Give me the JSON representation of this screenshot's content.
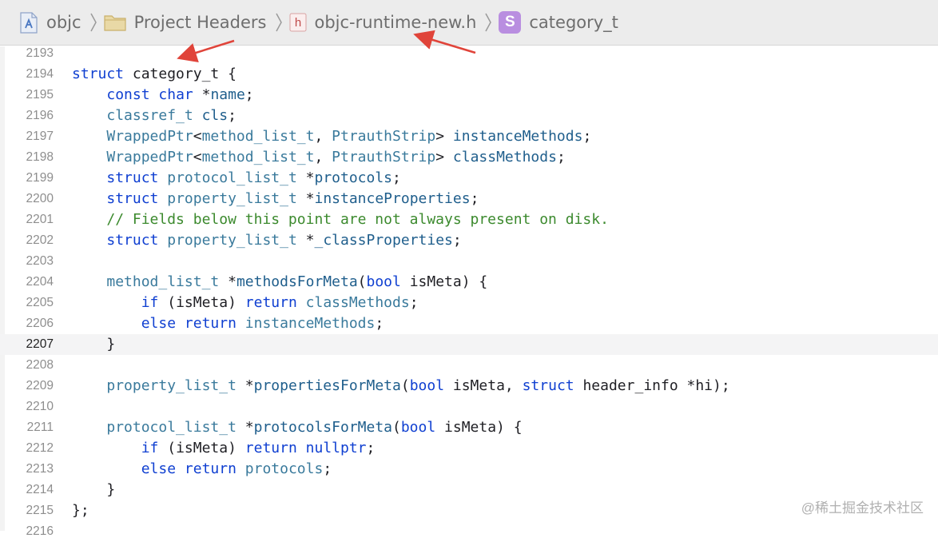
{
  "breadcrumb": {
    "items": [
      {
        "label": "objc",
        "icon": "xcode-project-icon"
      },
      {
        "label": "Project Headers",
        "icon": "folder-icon"
      },
      {
        "label": "objc-runtime-new.h",
        "icon": "header-file-icon",
        "icon_text": "h"
      },
      {
        "label": "category_t",
        "icon": "struct-symbol-icon",
        "icon_text": "S"
      }
    ]
  },
  "editor": {
    "current_line": "2207",
    "lines": [
      {
        "num": "2193",
        "tokens": []
      },
      {
        "num": "2194",
        "tokens": [
          [
            "kw",
            "struct"
          ],
          [
            "pl",
            " category_t {"
          ]
        ]
      },
      {
        "num": "2195",
        "tokens": [
          [
            "pl",
            "    "
          ],
          [
            "kw",
            "const"
          ],
          [
            "pl",
            " "
          ],
          [
            "kw",
            "char"
          ],
          [
            "pl",
            " *"
          ],
          [
            "fn",
            "name"
          ],
          [
            "pl",
            ";"
          ]
        ]
      },
      {
        "num": "2196",
        "tokens": [
          [
            "pl",
            "    "
          ],
          [
            "ty",
            "classref_t"
          ],
          [
            "pl",
            " "
          ],
          [
            "fn",
            "cls"
          ],
          [
            "pl",
            ";"
          ]
        ]
      },
      {
        "num": "2197",
        "tokens": [
          [
            "pl",
            "    "
          ],
          [
            "ty",
            "WrappedPtr"
          ],
          [
            "pl",
            "<"
          ],
          [
            "ty",
            "method_list_t"
          ],
          [
            "pl",
            ", "
          ],
          [
            "ty",
            "PtrauthStrip"
          ],
          [
            "pl",
            "> "
          ],
          [
            "fn",
            "instanceMethods"
          ],
          [
            "pl",
            ";"
          ]
        ]
      },
      {
        "num": "2198",
        "tokens": [
          [
            "pl",
            "    "
          ],
          [
            "ty",
            "WrappedPtr"
          ],
          [
            "pl",
            "<"
          ],
          [
            "ty",
            "method_list_t"
          ],
          [
            "pl",
            ", "
          ],
          [
            "ty",
            "PtrauthStrip"
          ],
          [
            "pl",
            "> "
          ],
          [
            "fn",
            "classMethods"
          ],
          [
            "pl",
            ";"
          ]
        ]
      },
      {
        "num": "2199",
        "tokens": [
          [
            "pl",
            "    "
          ],
          [
            "kw",
            "struct"
          ],
          [
            "pl",
            " "
          ],
          [
            "ty",
            "protocol_list_t"
          ],
          [
            "pl",
            " *"
          ],
          [
            "fn",
            "protocols"
          ],
          [
            "pl",
            ";"
          ]
        ]
      },
      {
        "num": "2200",
        "tokens": [
          [
            "pl",
            "    "
          ],
          [
            "kw",
            "struct"
          ],
          [
            "pl",
            " "
          ],
          [
            "ty",
            "property_list_t"
          ],
          [
            "pl",
            " *"
          ],
          [
            "fn",
            "instanceProperties"
          ],
          [
            "pl",
            ";"
          ]
        ]
      },
      {
        "num": "2201",
        "tokens": [
          [
            "pl",
            "    "
          ],
          [
            "cm",
            "// Fields below this point are not always present on disk."
          ]
        ]
      },
      {
        "num": "2202",
        "tokens": [
          [
            "pl",
            "    "
          ],
          [
            "kw",
            "struct"
          ],
          [
            "pl",
            " "
          ],
          [
            "ty",
            "property_list_t"
          ],
          [
            "pl",
            " *"
          ],
          [
            "fn",
            "_classProperties"
          ],
          [
            "pl",
            ";"
          ]
        ]
      },
      {
        "num": "2203",
        "tokens": []
      },
      {
        "num": "2204",
        "tokens": [
          [
            "pl",
            "    "
          ],
          [
            "ty",
            "method_list_t"
          ],
          [
            "pl",
            " *"
          ],
          [
            "fn",
            "methodsForMeta"
          ],
          [
            "pl",
            "("
          ],
          [
            "kw",
            "bool"
          ],
          [
            "pl",
            " isMeta) {"
          ]
        ]
      },
      {
        "num": "2205",
        "tokens": [
          [
            "pl",
            "        "
          ],
          [
            "kw",
            "if"
          ],
          [
            "pl",
            " (isMeta) "
          ],
          [
            "kw",
            "return"
          ],
          [
            "pl",
            " "
          ],
          [
            "ty",
            "classMethods"
          ],
          [
            "pl",
            ";"
          ]
        ]
      },
      {
        "num": "2206",
        "tokens": [
          [
            "pl",
            "        "
          ],
          [
            "kw",
            "else"
          ],
          [
            "pl",
            " "
          ],
          [
            "kw",
            "return"
          ],
          [
            "pl",
            " "
          ],
          [
            "ty",
            "instanceMethods"
          ],
          [
            "pl",
            ";"
          ]
        ]
      },
      {
        "num": "2207",
        "tokens": [
          [
            "pl",
            "    }"
          ]
        ]
      },
      {
        "num": "2208",
        "tokens": []
      },
      {
        "num": "2209",
        "tokens": [
          [
            "pl",
            "    "
          ],
          [
            "ty",
            "property_list_t"
          ],
          [
            "pl",
            " *"
          ],
          [
            "fn",
            "propertiesForMeta"
          ],
          [
            "pl",
            "("
          ],
          [
            "kw",
            "bool"
          ],
          [
            "pl",
            " isMeta, "
          ],
          [
            "kw",
            "struct"
          ],
          [
            "pl",
            " header_info *hi);"
          ]
        ]
      },
      {
        "num": "2210",
        "tokens": []
      },
      {
        "num": "2211",
        "tokens": [
          [
            "pl",
            "    "
          ],
          [
            "ty",
            "protocol_list_t"
          ],
          [
            "pl",
            " *"
          ],
          [
            "fn",
            "protocolsForMeta"
          ],
          [
            "pl",
            "("
          ],
          [
            "kw",
            "bool"
          ],
          [
            "pl",
            " isMeta) {"
          ]
        ]
      },
      {
        "num": "2212",
        "tokens": [
          [
            "pl",
            "        "
          ],
          [
            "kw",
            "if"
          ],
          [
            "pl",
            " (isMeta) "
          ],
          [
            "kw",
            "return"
          ],
          [
            "pl",
            " "
          ],
          [
            "kw",
            "nullptr"
          ],
          [
            "pl",
            ";"
          ]
        ]
      },
      {
        "num": "2213",
        "tokens": [
          [
            "pl",
            "        "
          ],
          [
            "kw",
            "else"
          ],
          [
            "pl",
            " "
          ],
          [
            "kw",
            "return"
          ],
          [
            "pl",
            " "
          ],
          [
            "ty",
            "protocols"
          ],
          [
            "pl",
            ";"
          ]
        ]
      },
      {
        "num": "2214",
        "tokens": [
          [
            "pl",
            "    }"
          ]
        ]
      },
      {
        "num": "2215",
        "tokens": [
          [
            "pl",
            "};"
          ]
        ]
      },
      {
        "num": "2216",
        "tokens": []
      }
    ]
  },
  "watermark": "@稀土掘金技术社区",
  "colors": {
    "keyword": "#0f3fd1",
    "type": "#3a7a9c",
    "identifier": "#1f5e8c",
    "comment": "#3c8a2e",
    "annotation_arrow": "#e0443a"
  }
}
